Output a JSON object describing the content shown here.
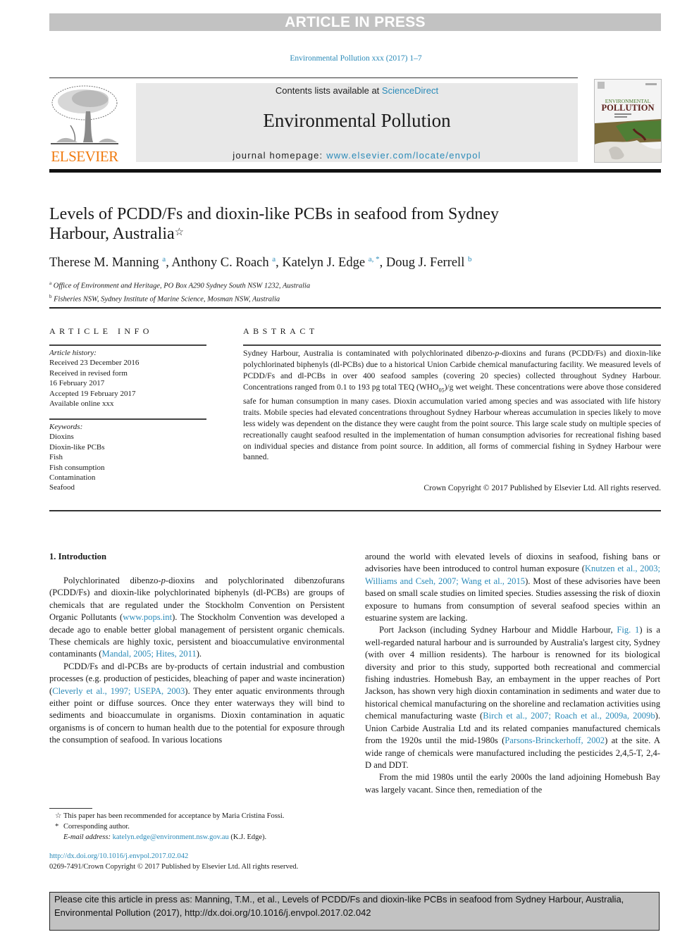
{
  "banner": "ARTICLE IN PRESS",
  "journal_ref": "Environmental Pollution xxx (2017) 1–7",
  "header": {
    "publisher": "ELSEVIER",
    "contents_prefix": "Contents lists available at ",
    "contents_link": "ScienceDirect",
    "journal_name": "Environmental Pollution",
    "homepage_prefix": "journal homepage: ",
    "homepage_link": "www.elsevier.com/locate/envpol",
    "cover_title_line1": "ENVIRONMENTAL",
    "cover_title_line2": "POLLUTION"
  },
  "article": {
    "title": "Levels of PCDD/Fs and dioxin-like PCBs in seafood from Sydney Harbour, Australia",
    "title_mark": "☆",
    "authors": [
      {
        "name": "Therese M. Manning",
        "sup": "a"
      },
      {
        "name": "Anthony C. Roach",
        "sup": "a"
      },
      {
        "name": "Katelyn J. Edge",
        "sup": "a, *"
      },
      {
        "name": "Doug J. Ferrell",
        "sup": "b"
      }
    ],
    "affiliations": [
      {
        "mark": "a",
        "text": "Office of Environment and Heritage, PO Box A290 Sydney South NSW 1232, Australia"
      },
      {
        "mark": "b",
        "text": "Fisheries NSW, Sydney Institute of Marine Science, Mosman NSW, Australia"
      }
    ]
  },
  "article_info": {
    "heading": "ARTICLE INFO",
    "history_label": "Article history:",
    "history": [
      "Received 23 December 2016",
      "Received in revised form",
      "16 February 2017",
      "Accepted 19 February 2017",
      "Available online xxx"
    ],
    "keywords_label": "Keywords:",
    "keywords": [
      "Dioxins",
      "Dioxin-like PCBs",
      "Fish",
      "Fish consumption",
      "Contamination",
      "Seafood"
    ]
  },
  "abstract": {
    "heading": "ABSTRACT",
    "text_part1": "Sydney Harbour, Australia is contaminated with polychlorinated dibenzo-",
    "italic_p": "p",
    "text_part2": "-dioxins and furans (PCDD/Fs) and dioxin-like polychlorinated biphenyls (dl-PCBs) due to a historical Union Carbide chemical manufacturing facility. We measured levels of PCDD/Fs and dl-PCBs in over 400 seafood samples (covering 20 species) collected throughout Sydney Harbour. Concentrations ranged from 0.1 to 193 pg total TEQ (WHO",
    "sub": "05",
    "text_part3": ")/g wet weight. These concentrations were above those considered safe for human consumption in many cases. Dioxin accumulation varied among species and was associated with life history traits. Mobile species had elevated concentrations throughout Sydney Harbour whereas accumulation in species likely to move less widely was dependent on the distance they were caught from the point source. This large scale study on multiple species of recreationally caught seafood resulted in the implementation of human consumption advisories for recreational fishing based on individual species and distance from point source. In addition, all forms of commercial fishing in Sydney Harbour were banned.",
    "copyright": "Crown Copyright © 2017 Published by Elsevier Ltd. All rights reserved."
  },
  "body": {
    "section_heading": "1.  Introduction",
    "left": {
      "p1_a": "Polychlorinated dibenzo-",
      "p1_italic": "p",
      "p1_b": "-dioxins and polychlorinated dibenzofurans (PCDD/Fs) and dioxin-like polychlorinated biphenyls (dl-PCBs) are groups of chemicals that are regulated under the Stockholm Convention on Persistent Organic Pollutants (",
      "p1_link1": "www.pops.int",
      "p1_c": "). The Stockholm Convention was developed a decade ago to enable better global management of persistent organic chemicals. These chemicals are highly toxic, persistent and bioaccumulative environmental contaminants (",
      "p1_link2": "Mandal, 2005; Hites, 2011",
      "p1_d": ").",
      "p2_a": "PCDD/Fs and dl-PCBs are by-products of certain industrial and combustion processes (e.g. production of pesticides, bleaching of paper and waste incineration) (",
      "p2_link": "Cleverly et al., 1997; USEPA, 2003",
      "p2_b": "). They enter aquatic environments through either point or diffuse sources. Once they enter waterways they will bind to sediments and bioaccumulate in organisms. Dioxin contamination in aquatic organisms is of concern to human health due to the potential for exposure through the consumption of seafood. In various locations"
    },
    "right": {
      "p1_a": "around the world with elevated levels of dioxins in seafood, fishing bans or advisories have been introduced to control human exposure (",
      "p1_link": "Knutzen et al., 2003; Williams and Cseh, 2007; Wang et al., 2015",
      "p1_b": "). Most of these advisories have been based on small scale studies on limited species. Studies assessing the risk of dioxin exposure to humans from consumption of several seafood species within an estuarine system are lacking.",
      "p2_a": "Port Jackson (including Sydney Harbour and Middle Harbour, ",
      "p2_link1": "Fig. 1",
      "p2_b": ") is a well-regarded natural harbour and is surrounded by Australia's largest city, Sydney (with over 4 million residents). The harbour is renowned for its biological diversity and prior to this study, supported both recreational and commercial fishing industries. Homebush Bay, an embayment in the upper reaches of Port Jackson, has shown very high dioxin contamination in sediments and water due to historical chemical manufacturing on the shoreline and reclamation activities using chemical manufacturing waste (",
      "p2_link2": "Birch et al., 2007; Roach et al., 2009a, 2009b",
      "p2_c": "). Union Carbide Australia Ltd and its related companies manufactured chemicals from the 1920s until the mid-1980s (",
      "p2_link3": "Parsons-Brinckerhoff, 2002",
      "p2_d": ") at the site. A wide range of chemicals were manufactured including the pesticides 2,4,5-T, 2,4-D and DDT.",
      "p3": "From the mid 1980s until the early 2000s the land adjoining Homebush Bay was largely vacant. Since then, remediation of the"
    }
  },
  "footnotes": {
    "fn1_mark": "☆",
    "fn1": "This paper has been recommended for acceptance by Maria Cristina Fossi.",
    "fn2_mark": "*",
    "fn2": "Corresponding author.",
    "email_label": "E-mail address: ",
    "email": "katelyn.edge@environment.nsw.gov.au",
    "email_suffix": " (K.J. Edge).",
    "doi": "http://dx.doi.org/10.1016/j.envpol.2017.02.042",
    "issn": "0269-7491/Crown Copyright © 2017 Published by Elsevier Ltd. All rights reserved."
  },
  "cite_box": "Please cite this article in press as: Manning, T.M., et al., Levels of PCDD/Fs and dioxin-like PCBs in seafood from Sydney Harbour, Australia, Environmental Pollution (2017), http://dx.doi.org/10.1016/j.envpol.2017.02.042"
}
